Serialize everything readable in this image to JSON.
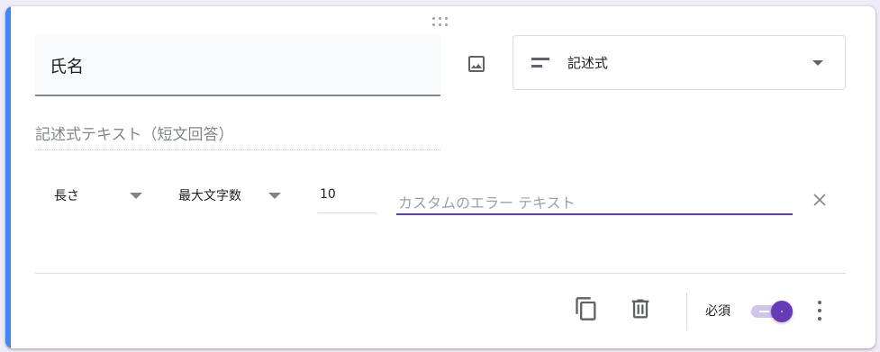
{
  "question": {
    "title": "氏名",
    "answer_placeholder": "記述式テキスト（短文回答）"
  },
  "type_select": {
    "selected": "記述式",
    "icon": "short-text-icon"
  },
  "validation": {
    "type": "長さ",
    "rule": "最大文字数",
    "value": "10",
    "error_placeholder": "カスタムのエラー テキスト"
  },
  "footer": {
    "required_label": "必須",
    "required": true
  },
  "icons": {
    "drag": "drag-handle-icon",
    "image": "image-icon",
    "clear": "close-icon",
    "copy": "copy-icon",
    "delete": "trash-icon",
    "more": "more-vert-icon"
  },
  "colors": {
    "accent": "#4285f4",
    "primary": "#673ab7",
    "toggle_track": "#d1c4e9"
  }
}
